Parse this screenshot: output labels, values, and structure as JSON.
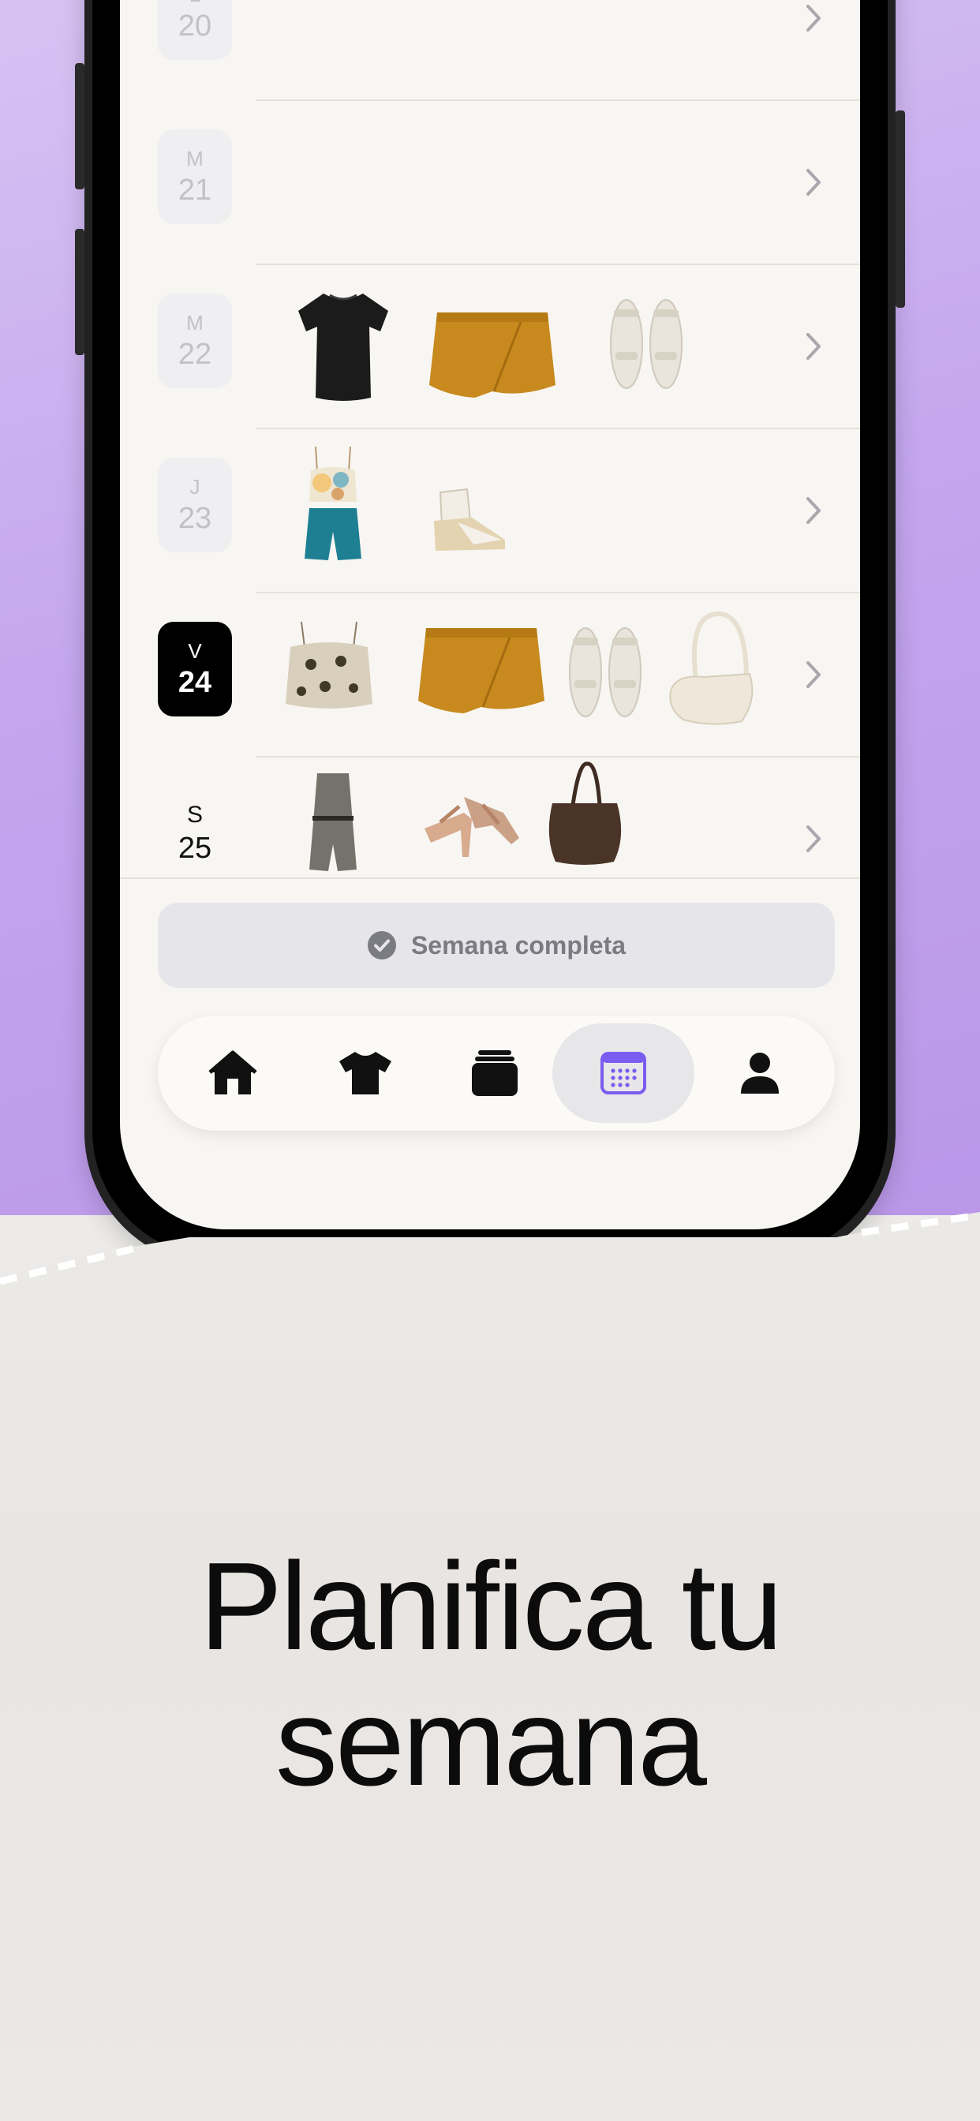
{
  "days": [
    {
      "letter": "L",
      "number": "20",
      "state": "past"
    },
    {
      "letter": "M",
      "number": "21",
      "state": "past"
    },
    {
      "letter": "M",
      "number": "22",
      "state": "past"
    },
    {
      "letter": "J",
      "number": "23",
      "state": "past"
    },
    {
      "letter": "V",
      "number": "24",
      "state": "today"
    },
    {
      "letter": "S",
      "number": "25",
      "state": "upcoming"
    }
  ],
  "outfits": {
    "day22": [
      "black-tshirt",
      "mustard-skort",
      "white-sandals"
    ],
    "day23": [
      "floral-teal-set",
      "espadrille-wedges"
    ],
    "day24": [
      "beige-embroidered-top",
      "mustard-skort",
      "white-sandals",
      "cream-shoulder-bag"
    ],
    "day25": [
      "grey-romper",
      "strappy-heels",
      "brown-tote-bag"
    ]
  },
  "complete_button": {
    "label": "Semana completa",
    "icon": "check-circle-icon"
  },
  "tabbar": {
    "tabs": [
      "home-icon",
      "tshirt-icon",
      "stack-icon",
      "calendar-icon",
      "person-icon"
    ],
    "active": "calendar-icon"
  },
  "colors": {
    "accent": "#7b5cf0",
    "purple_bg": "#c4a6ee",
    "screen_bg": "#f8f6f2"
  },
  "headline": {
    "line1": "Planifica tu",
    "line2": "semana"
  }
}
